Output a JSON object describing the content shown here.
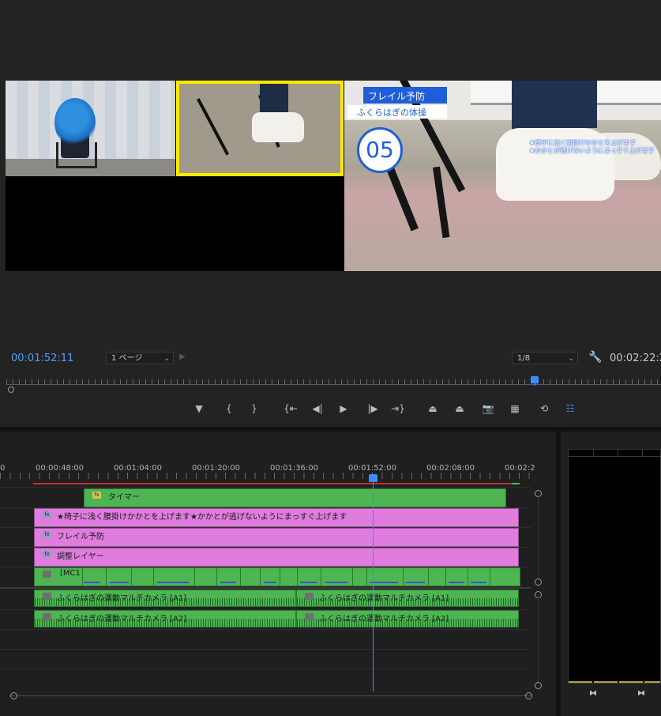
{
  "monitor": {
    "overlay_title": "フレイル予防",
    "overlay_subtitle": "ふくらはぎの体操",
    "overlay_number": "05",
    "caption_line1": "★椅子に浅く腰掛けかかとを上げます",
    "caption_line2": "★かかとが逃げないようにまっすぐ上げます"
  },
  "controls": {
    "current_timecode": "00:01:52:11",
    "page_select": "1 ページ",
    "zoom_select": "1/8",
    "duration_timecode": "00:02:22:2",
    "transport_buttons": [
      {
        "name": "add-marker-button",
        "glyph": "▼"
      },
      {
        "name": "mark-in-button",
        "glyph": "{"
      },
      {
        "name": "mark-out-button",
        "glyph": "}"
      },
      {
        "name": "go-to-in-button",
        "glyph": "{⇤"
      },
      {
        "name": "step-back-button",
        "glyph": "◀|"
      },
      {
        "name": "play-button",
        "glyph": "▶"
      },
      {
        "name": "step-forward-button",
        "glyph": "|▶"
      },
      {
        "name": "go-to-out-button",
        "glyph": "⇥}"
      },
      {
        "name": "lift-button",
        "glyph": "⏏"
      },
      {
        "name": "extract-button",
        "glyph": "⏏"
      },
      {
        "name": "export-frame-button",
        "glyph": "📷"
      },
      {
        "name": "multicam-button",
        "glyph": "▦"
      },
      {
        "name": "toggle-proxies-button",
        "glyph": "⟲"
      },
      {
        "name": "multicam-view-button",
        "glyph": "☷"
      }
    ]
  },
  "timeline": {
    "ruler_labels": [
      "0",
      "00:00:48:00",
      "00:01:04:00",
      "00:01:20:00",
      "00:01:36:00",
      "00:01:52:00",
      "00:02:08:00",
      "00:02:2"
    ],
    "clips": {
      "timer": "タイマー",
      "caption": "★椅子に浅く腰掛けかかとを上げます★かかとが逃げないようにまっすぐ上げます",
      "frail": "フレイル予防",
      "adjustment": "調整レイヤー",
      "multicam": "[MC1",
      "audio_a1_1": "ふくらはぎの運動マルチカメラ [A1]",
      "audio_a1_2": "ふくらはぎの運動マルチカメラ [A1]",
      "audio_a2_1": "ふくらはぎの運動マルチカメラ [A2]",
      "audio_a2_2": "ふくらはぎの運動マルチカメラ [A2]"
    },
    "fx_badge": "fx"
  },
  "audio_panel": {
    "left_button": "⧓",
    "right_button": "⧓"
  },
  "colors": {
    "accent": "#3b8cff",
    "clip_green": "#4db552",
    "clip_pink": "#df7cde",
    "title_blue": "#1f5ed8",
    "selection_yellow": "#ffe800"
  }
}
